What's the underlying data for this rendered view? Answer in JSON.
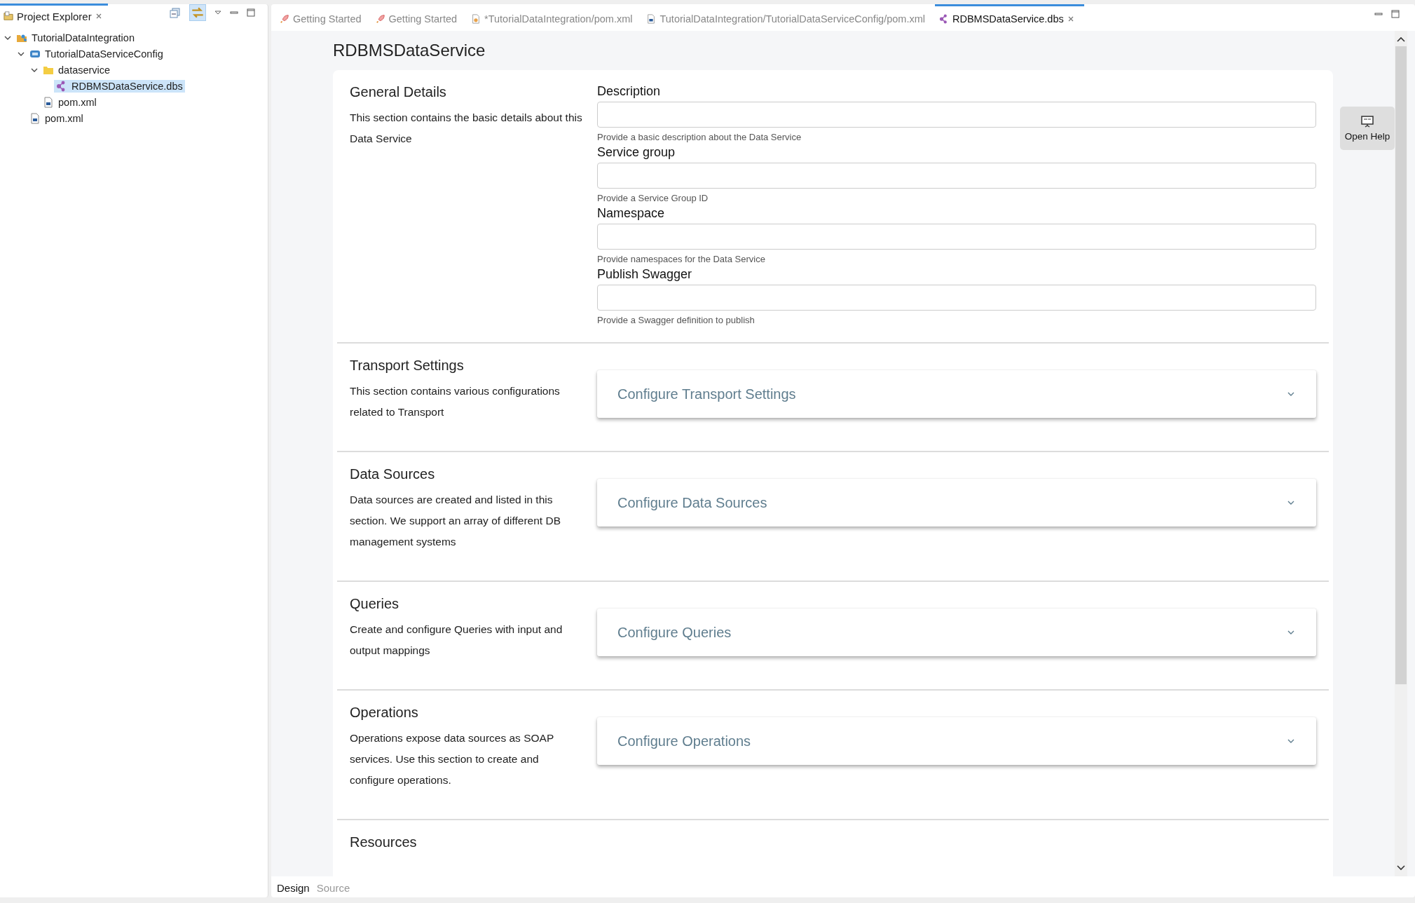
{
  "explorer": {
    "title": "Project Explorer",
    "selected": true,
    "tree": [
      {
        "label": "TutorialDataIntegration",
        "kind": "project",
        "expanded": true,
        "selected": false,
        "children": [
          {
            "label": "TutorialDataServiceConfig",
            "kind": "config",
            "expanded": true,
            "selected": false,
            "children": [
              {
                "label": "dataservice",
                "kind": "folder",
                "expanded": true,
                "selected": false,
                "children": [
                  {
                    "label": "RDBMSDataService.dbs",
                    "kind": "dbs",
                    "selected": true
                  }
                ]
              },
              {
                "label": "pom.xml",
                "kind": "pom",
                "selected": false
              }
            ]
          },
          {
            "label": "pom.xml",
            "kind": "pom",
            "selected": false
          }
        ]
      }
    ]
  },
  "editor_tabs": [
    {
      "label": "Getting Started",
      "kind": "rocket",
      "selected": false
    },
    {
      "label": "Getting Started",
      "kind": "rocket",
      "selected": false
    },
    {
      "label": "*TutorialDataIntegration/pom.xml",
      "kind": "pomedit",
      "selected": false
    },
    {
      "label": "TutorialDataIntegration/TutorialDataServiceConfig/pom.xml",
      "kind": "pom",
      "selected": false
    },
    {
      "label": "RDBMSDataService.dbs",
      "kind": "dbs",
      "selected": true
    }
  ],
  "page_title": "RDBMSDataService",
  "sections": [
    {
      "kind": "fields",
      "title": "General Details",
      "description": "This section contains the basic details about this Data Service",
      "fields": [
        {
          "label": "Description",
          "hint": "Provide a basic description about the Data Service"
        },
        {
          "label": "Service group",
          "hint": "Provide a Service Group ID"
        },
        {
          "label": "Namespace",
          "hint": "Provide namespaces for the Data Service"
        },
        {
          "label": "Publish Swagger",
          "hint": "Provide a Swagger definition to publish"
        }
      ]
    },
    {
      "kind": "accordion",
      "title": "Transport Settings",
      "description": "This section contains various configurations related to Transport",
      "accordion": "Configure Transport Settings",
      "expanded": false
    },
    {
      "kind": "accordion",
      "title": "Data Sources",
      "description": "Data sources are created and listed in this section. We support an array of different DB management systems",
      "accordion": "Configure Data Sources",
      "expanded": false
    },
    {
      "kind": "accordion",
      "title": "Queries",
      "description": "Create and configure Queries with input and output mappings",
      "accordion": "Configure Queries",
      "expanded": false
    },
    {
      "kind": "accordion",
      "title": "Operations",
      "description": "Operations expose data sources as SOAP services. Use this section to create and configure operations.",
      "accordion": "Configure Operations",
      "expanded": false
    },
    {
      "kind": "title",
      "title": "Resources"
    }
  ],
  "help_button": "Open Help",
  "bottom_tabs": [
    {
      "label": "Design",
      "selected": true
    },
    {
      "label": "Source",
      "selected": false
    }
  ]
}
